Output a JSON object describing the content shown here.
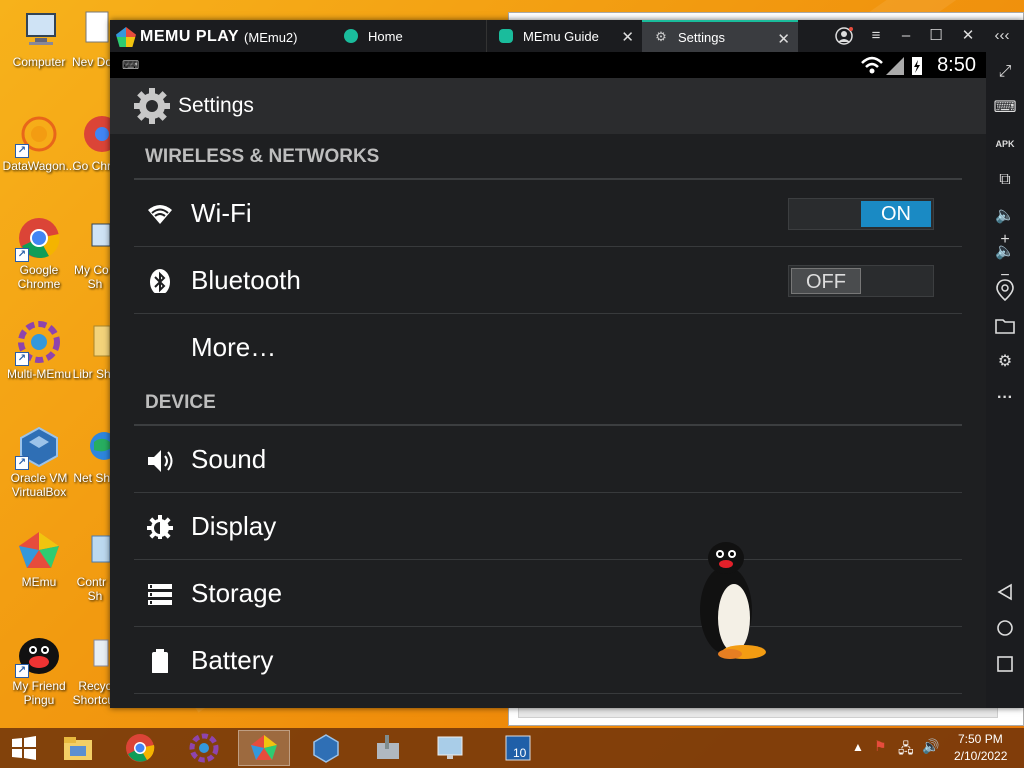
{
  "desktop": {
    "icons": [
      {
        "label": "Computer",
        "icon": "computer-icon"
      },
      {
        "label": "DataWagon...",
        "icon": "datawagon-icon"
      },
      {
        "label": "Google Chrome",
        "icon": "chrome-icon"
      },
      {
        "label": "Multi-MEmu",
        "icon": "multi-memu-icon"
      },
      {
        "label": "Oracle VM VirtualBox",
        "icon": "virtualbox-icon"
      },
      {
        "label": "MEmu",
        "icon": "memu-icon"
      },
      {
        "label": "My Friend Pingu",
        "icon": "pingu-icon"
      }
    ],
    "icons_col2": [
      {
        "label": "Nev Doc",
        "icon": "document-icon"
      },
      {
        "label": "Go Chro",
        "icon": "chrome-icon"
      },
      {
        "label": "My Co - Sh",
        "icon": "computer-icon"
      },
      {
        "label": "Libr Sho",
        "icon": "library-icon"
      },
      {
        "label": "Net Sho",
        "icon": "network-icon"
      },
      {
        "label": "Contr - Sh",
        "icon": "control-panel-icon"
      },
      {
        "label": "Recyc Shortcut",
        "icon": "recycle-bin-icon"
      }
    ]
  },
  "memu": {
    "brand": "MEMU PLAY",
    "instance": "(MEmu2)",
    "tabs": [
      {
        "label": "Home",
        "icon": "home-app-icon",
        "active": false,
        "closable": false
      },
      {
        "label": "MEmu Guide",
        "icon": "guide-icon",
        "active": false,
        "closable": true
      },
      {
        "label": "Settings",
        "icon": "settings-gear-icon",
        "active": true,
        "closable": true
      }
    ],
    "window_buttons": [
      "account-icon",
      "menu-icon",
      "minimize-icon",
      "maximize-icon",
      "close-icon",
      "collapse-icon"
    ]
  },
  "android": {
    "clock": "8:50",
    "title": "Settings",
    "sections": [
      {
        "header": "WIRELESS & NETWORKS",
        "items": [
          {
            "label": "Wi-Fi",
            "icon": "wifi-icon",
            "toggle": "ON"
          },
          {
            "label": "Bluetooth",
            "icon": "bluetooth-icon",
            "toggle": "OFF"
          },
          {
            "label": "More…",
            "icon": "",
            "toggle": ""
          }
        ]
      },
      {
        "header": "DEVICE",
        "items": [
          {
            "label": "Sound",
            "icon": "speaker-icon"
          },
          {
            "label": "Display",
            "icon": "brightness-icon"
          },
          {
            "label": "Storage",
            "icon": "storage-icon"
          },
          {
            "label": "Battery",
            "icon": "battery-icon"
          }
        ]
      }
    ]
  },
  "sidebar": {
    "buttons": [
      "fullscreen-icon",
      "keyboard-icon",
      "apk-icon",
      "multi-window-icon",
      "volume-up-icon",
      "volume-down-icon",
      "location-icon",
      "folder-icon",
      "settings-icon",
      "more-icon"
    ],
    "nav": [
      "back-icon",
      "home-icon",
      "recents-icon"
    ]
  },
  "taskbar": {
    "time": "7:50 PM",
    "date": "2/10/2022"
  }
}
